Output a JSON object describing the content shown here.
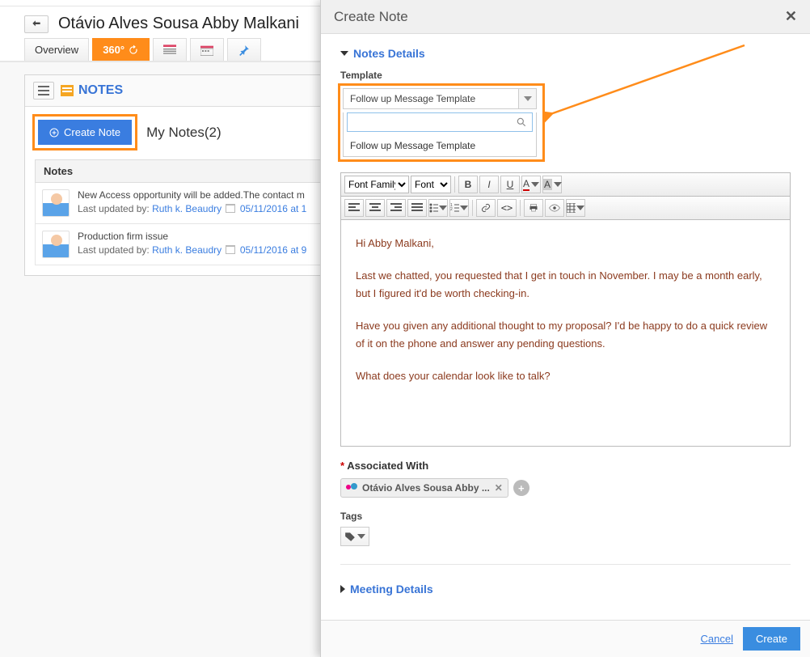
{
  "page": {
    "title": "Otávio Alves Sousa Abby Malkani",
    "tabs": {
      "overview": "Overview",
      "threeSixty": "360°"
    }
  },
  "notes_panel": {
    "title": "NOTES",
    "create_btn": "Create Note",
    "my_notes": "My Notes(2)",
    "column_header": "Notes",
    "items": [
      {
        "title": "New Access opportunity will be added.The contact m",
        "updated_by_label": "Last updated by:",
        "updated_by": "Ruth k. Beaudry",
        "date": "05/11/2016 at 1"
      },
      {
        "title": "Production firm issue",
        "updated_by_label": "Last updated by:",
        "updated_by": "Ruth k. Beaudry",
        "date": "05/11/2016 at 9"
      }
    ]
  },
  "modal": {
    "title": "Create Note",
    "section_notes": "Notes Details",
    "template_label": "Template",
    "template_selected": "Follow up Message Template",
    "template_options": [
      "Follow up Message Template"
    ],
    "toolbar": {
      "font_family": "Font Family",
      "font_size": "Font Si"
    },
    "body": {
      "p1": "Hi Abby Malkani,",
      "p2": "Last we chatted, you requested that I get in touch in November. I may be a month early, but I figured it'd be worth checking-in.",
      "p3": "Have you given any additional thought to my proposal? I'd be happy to do a quick review of it on the phone and answer any pending questions.",
      "p4": "What does your calendar look like to talk?"
    },
    "associated_label": "Associated With",
    "associated_chip": "Otávio Alves Sousa Abby ...",
    "tags_label": "Tags",
    "section_meeting": "Meeting Details",
    "cancel": "Cancel",
    "create": "Create"
  }
}
